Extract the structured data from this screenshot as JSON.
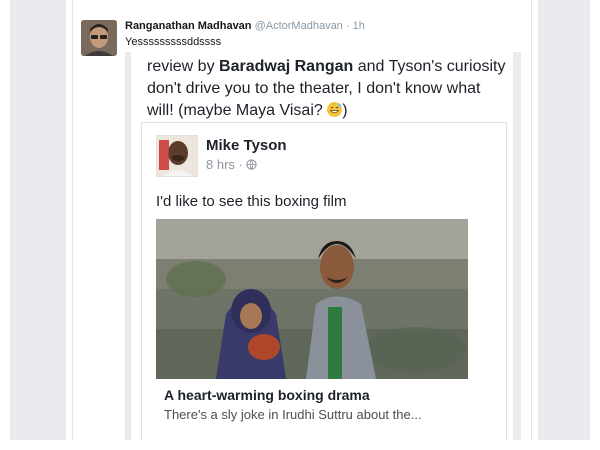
{
  "tweet": {
    "author_name": "Ranganathan Madhavan",
    "author_handle": "@ActorMadhavan",
    "separator": "·",
    "time": "1h",
    "text": "Yesssssssssddssss"
  },
  "embedded_screenshot": {
    "review_line1_prefix": "review by ",
    "review_bold": "Baradwaj Rangan",
    "review_line1_suffix": " and Tyson's curiosity don't drive you to the theater, I don't know what will! (maybe Maya Visai? ",
    "review_close": ")",
    "emoji": "grinning-sweat-emoji",
    "facebook_post": {
      "name": "Mike Tyson",
      "meta": "8 hrs · ",
      "privacy_icon": "globe-icon",
      "text": "I'd like to see this boxing film",
      "link_title": "A heart-warming boxing drama",
      "link_description": "There's a sly joke in Irudhi Suttru about the..."
    }
  },
  "colors": {
    "side_panels": "#e8eaed",
    "handle_gray": "#8899a6",
    "text_dark": "#1d2129"
  }
}
